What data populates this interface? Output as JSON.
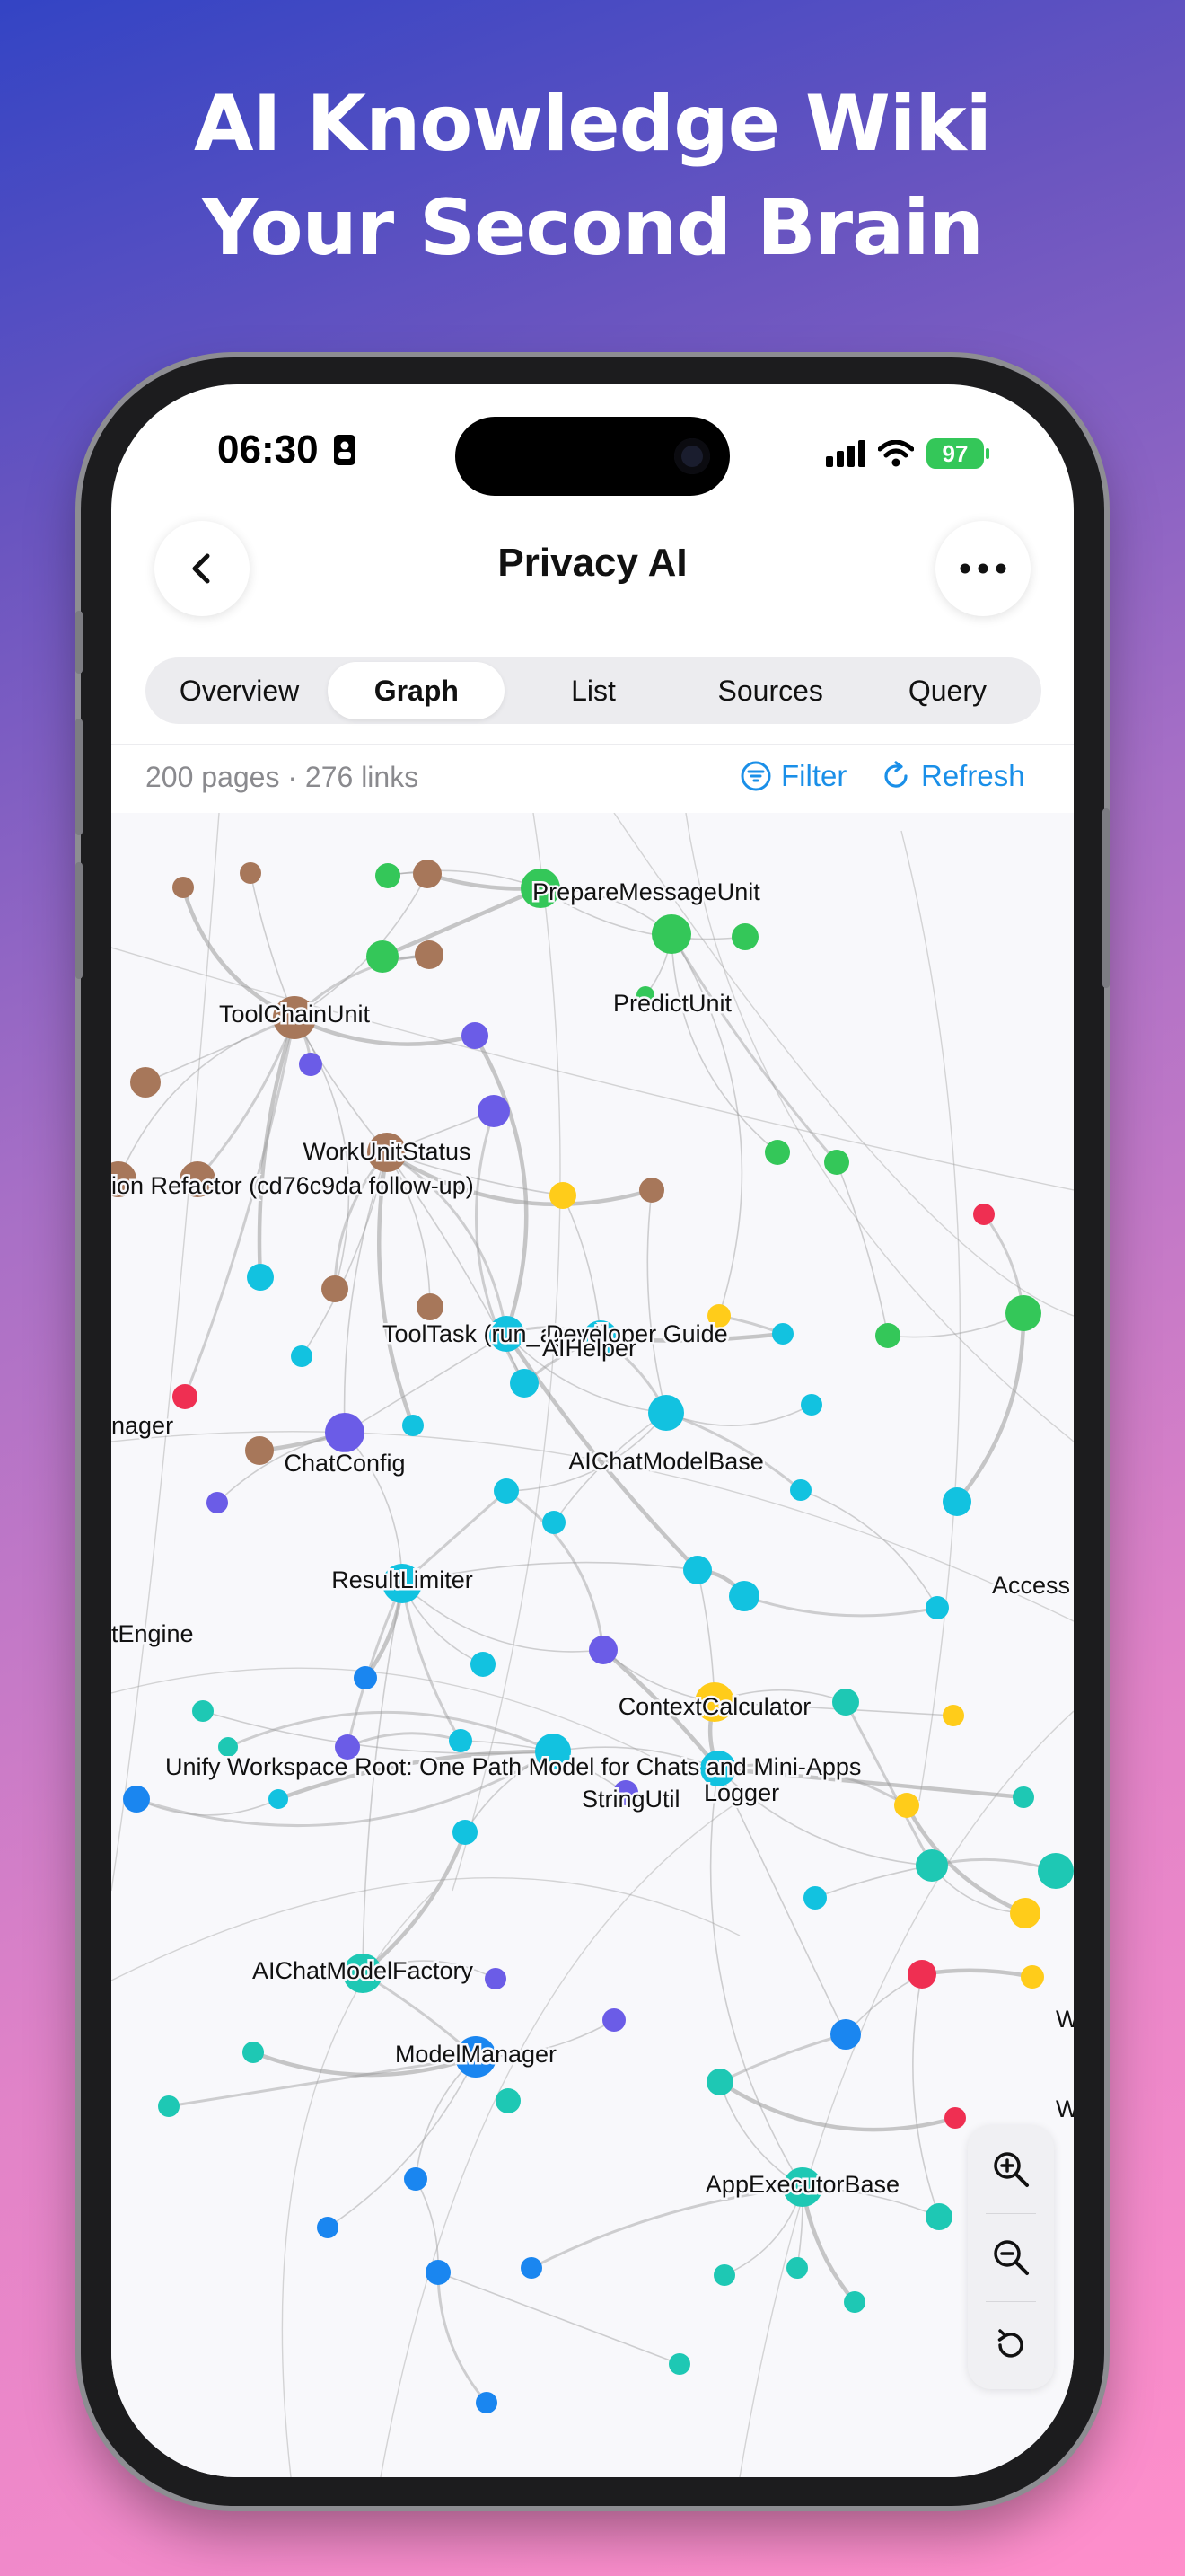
{
  "headline": {
    "line1": "AI Knowledge Wiki",
    "line2": "Your Second Brain"
  },
  "status_bar": {
    "time": "06:30",
    "battery": "97"
  },
  "nav": {
    "title": "Privacy AI",
    "back_icon": "chevron-left-icon",
    "more_icon": "ellipsis-icon"
  },
  "tabs": [
    {
      "label": "Overview",
      "active": false
    },
    {
      "label": "Graph",
      "active": true
    },
    {
      "label": "List",
      "active": false
    },
    {
      "label": "Sources",
      "active": false
    },
    {
      "label": "Query",
      "active": false
    }
  ],
  "toolbar": {
    "stats": "200 pages · 276 links",
    "filter_label": "Filter",
    "refresh_label": "Refresh"
  },
  "colors": {
    "accent": "#1a8fe8",
    "brown": "#a7775a",
    "green": "#34c759",
    "purple": "#6b5ce7",
    "cyan": "#12c2e0",
    "teal": "#1ec8b4",
    "blue": "#1a86f0",
    "yellow": "#ffcc1a",
    "red": "#ef2f52",
    "edge": "#9a9a9a"
  },
  "graph": {
    "labels": [
      "PrepareMessageUnit",
      "PredictUnit",
      "ToolChainUnit",
      "WorkUnitStatus",
      "ion Refactor (cd76c9da follow-up)",
      "ToolTask (run_agent)",
      "Developer Guide",
      "AIHelper",
      "nager",
      "ChatConfig",
      "AIChatModelBase",
      "ResultLimiter",
      "Access",
      "tEngine",
      "ContextCalculator",
      "Unify Workspace Root: One Path Model for Chats and Mini-Apps",
      "Logger",
      "StringUtil",
      "AIChatModelFactory",
      "ModelManager",
      "W",
      "W",
      "AppExecutorBase"
    ]
  },
  "zoom_controls": {
    "zoom_in_icon": "zoom-in-icon",
    "zoom_out_icon": "zoom-out-icon",
    "reset_icon": "reset-icon"
  }
}
